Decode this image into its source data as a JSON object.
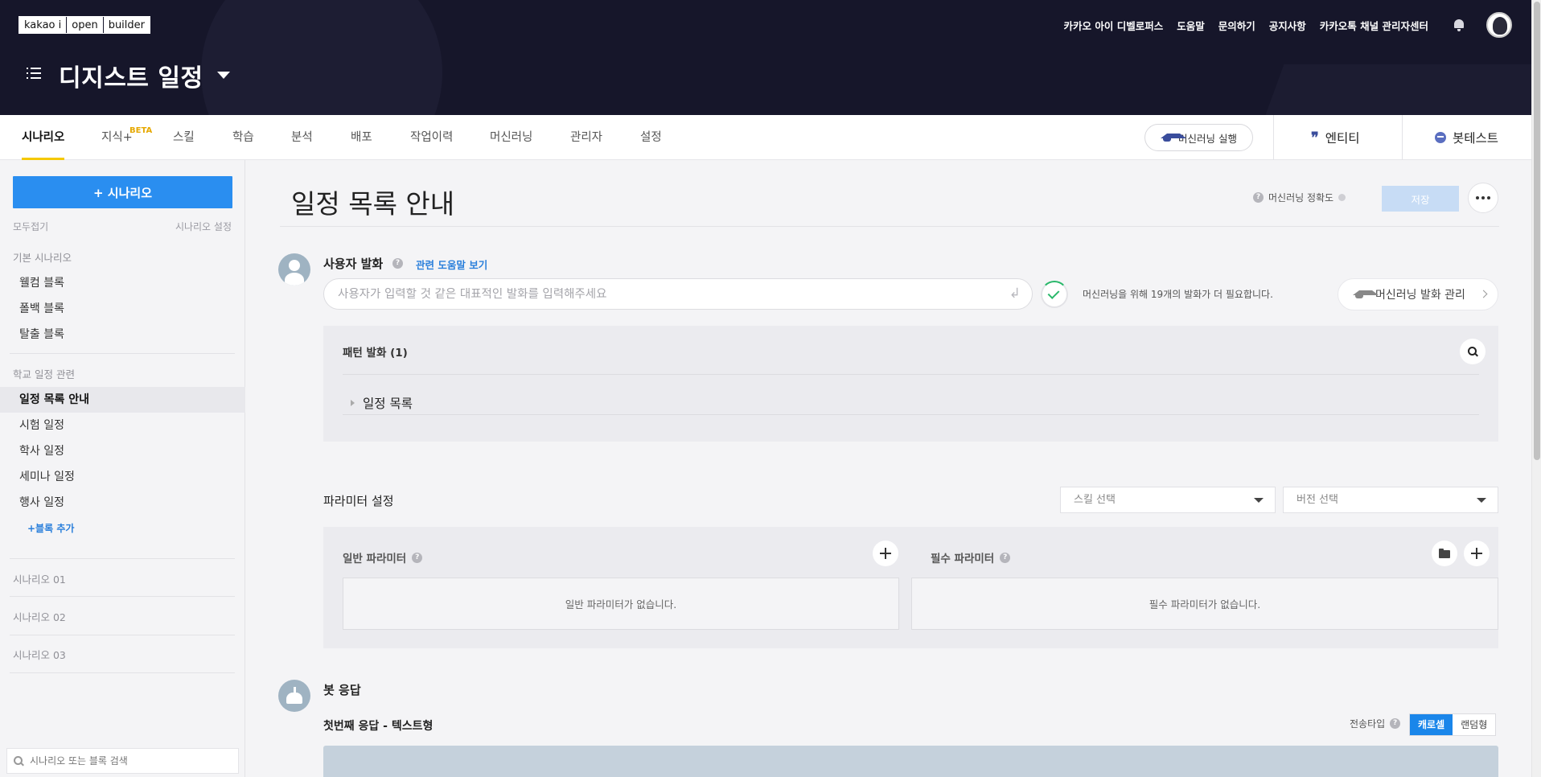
{
  "header": {
    "logo_parts": [
      "kakao i",
      "open",
      "builder"
    ],
    "project_title": "디지스트 일정",
    "links": [
      "카카오 아이 디벨로퍼스",
      "도움말",
      "문의하기",
      "공지사항",
      "카카오톡 채널 관리자센터"
    ]
  },
  "tabs": {
    "items": [
      "시나리오",
      "지식+",
      "스킬",
      "학습",
      "분석",
      "배포",
      "작업이력",
      "머신러닝",
      "관리자",
      "설정"
    ],
    "beta": "BETA",
    "ml_run": "머신러닝 실행",
    "entity": "엔티티",
    "bot_test": "봇테스트"
  },
  "sidebar": {
    "add_button": "+ 시나리오",
    "collapse_all": "모두접기",
    "scenario_settings": "시나리오 설정",
    "basic_section": "기본 시나리오",
    "basic_items": [
      "웰컴 블록",
      "폴백 블록",
      "탈출 블록"
    ],
    "school_section": "학교 일정 관련",
    "school_items": [
      "일정 목록 안내",
      "시험 일정",
      "학사 일정",
      "세미나 일정",
      "행사 일정"
    ],
    "add_block": "+블록 추가",
    "scenarios": [
      "시나리오 01",
      "시나리오 02",
      "시나리오 03"
    ],
    "search_placeholder": "시나리오 또는 블록 검색"
  },
  "main": {
    "title": "일정 목록 안내",
    "ml_accuracy": "머신러닝 정확도",
    "save": "저장",
    "user_utterance": "사용자 발화",
    "help_link": "관련 도움말 보기",
    "utterance_placeholder": "사용자가 입력할 것 같은 대표적인 발화를 입력해주세요",
    "ml_note": "머신러닝을 위해 19개의 발화가 더 필요합니다.",
    "ml_manage": "머신러닝 발화 관리",
    "pattern_title": "패턴 발화 (1)",
    "pattern_item": "일정 목록",
    "param_title": "파라미터 설정",
    "skill_select": "스킬 선택",
    "version_select": "버전 선택",
    "general_param": "일반 파라미터",
    "required_param": "필수 파라미터",
    "general_empty": "일반 파라미터가 없습니다.",
    "required_empty": "필수 파라미터가 없습니다.",
    "bot_response": "봇 응답",
    "first_response": "첫번째 응답 - 텍스트형",
    "send_type": "전송타입",
    "carousel": "캐로셀",
    "random": "랜덤형"
  }
}
